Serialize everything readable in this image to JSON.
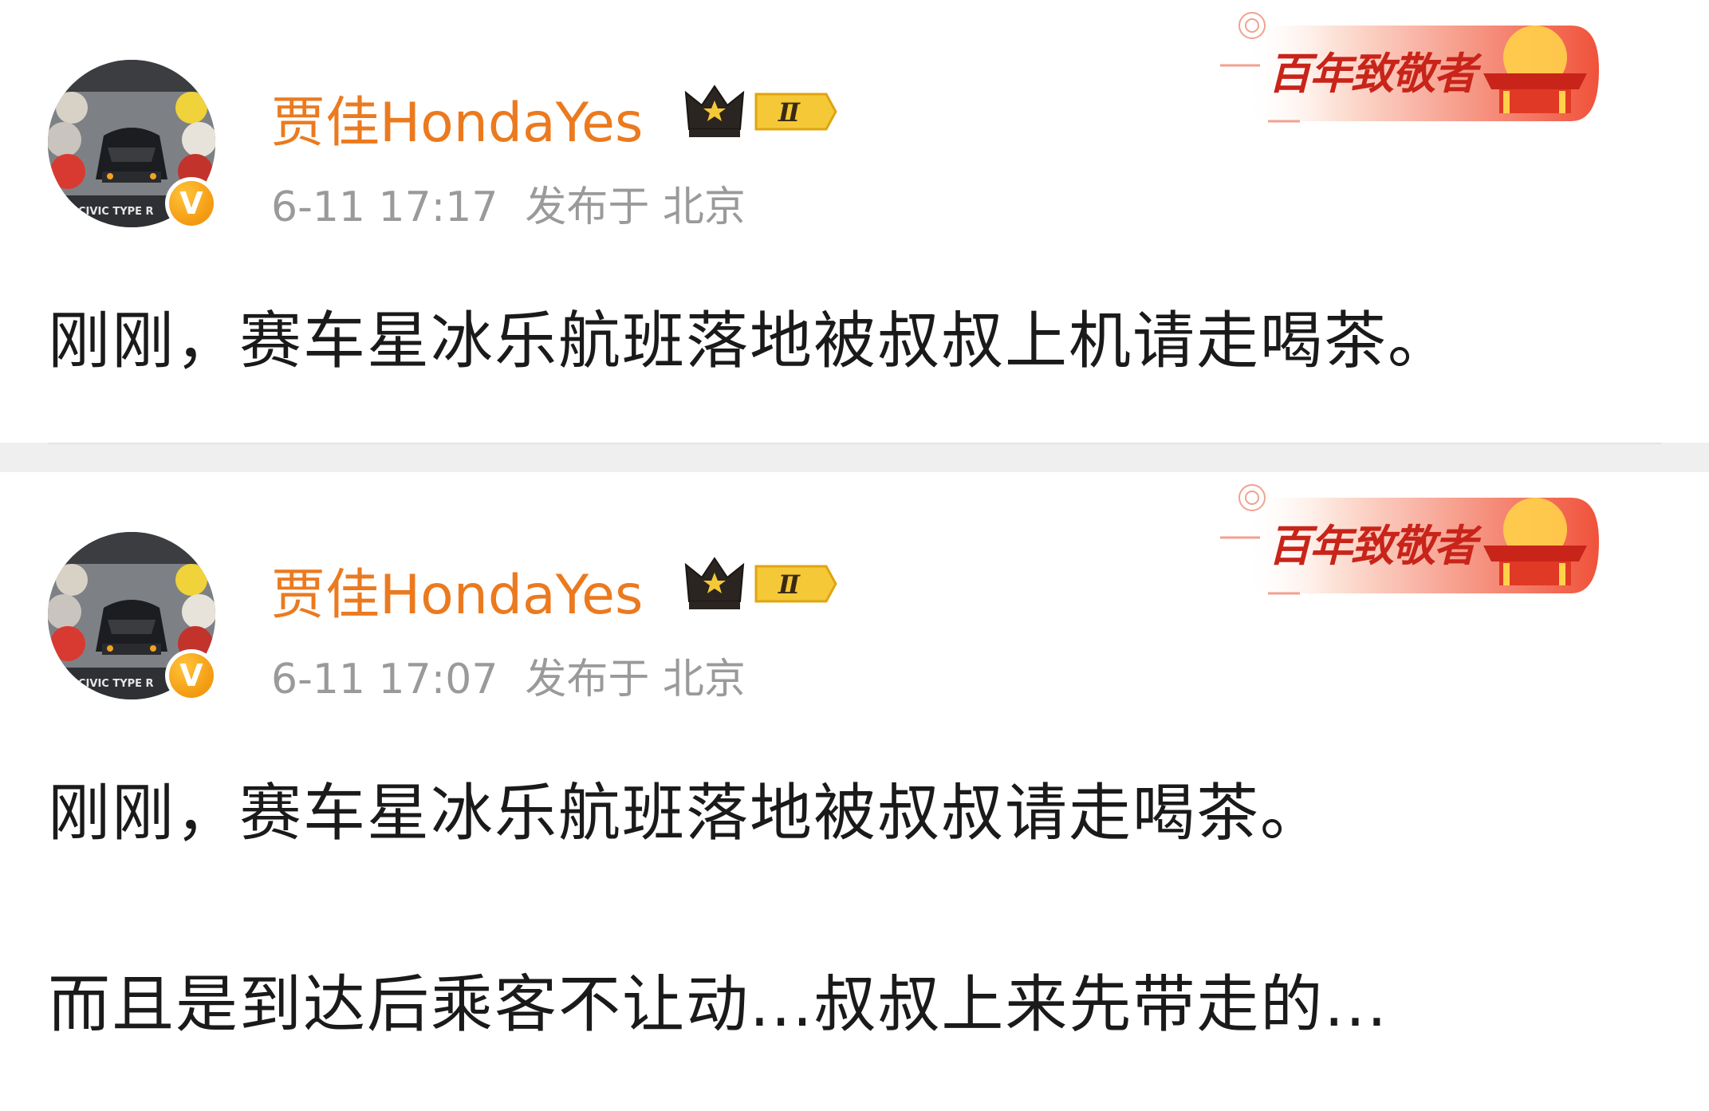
{
  "posts": [
    {
      "username": "贾佳HondaYes",
      "vip_level": "Ⅱ",
      "date": "6-11 17:17",
      "location": "发布于 北京",
      "badge_text": "百年致敬者",
      "paragraphs": [
        "刚刚，赛车星冰乐航班落地被叔叔上机请走喝茶。"
      ]
    },
    {
      "username": "贾佳HondaYes",
      "vip_level": "Ⅱ",
      "date": "6-11 17:07",
      "location": "发布于 北京",
      "badge_text": "百年致敬者",
      "paragraphs": [
        "刚刚，赛车星冰乐航班落地被叔叔请走喝茶。",
        "而且是到达后乘客不让动...叔叔上来先带走的..."
      ]
    }
  ],
  "avatar_text": "CIVIC TYPE R",
  "verified_mark": "V",
  "colors": {
    "username": "#eb7a1f",
    "meta": "#9a9a9a",
    "content": "#1a1a1a",
    "badge": "#e8432c",
    "separator": "#efefef"
  }
}
